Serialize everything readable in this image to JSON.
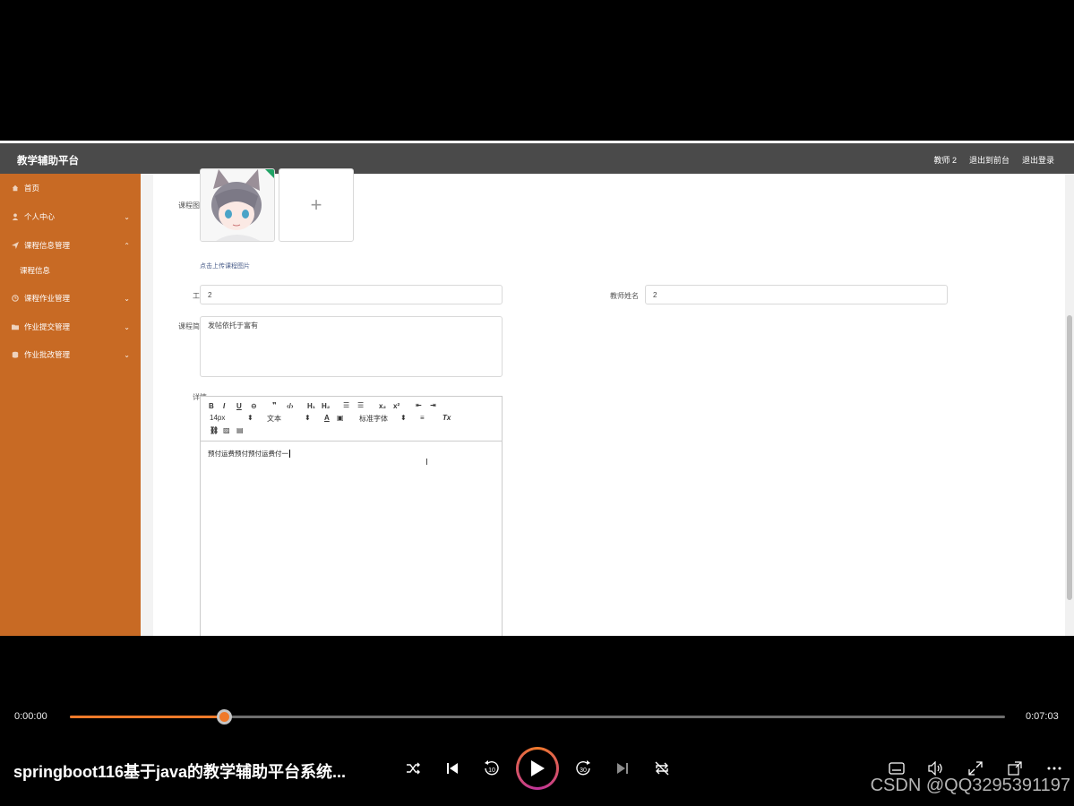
{
  "app": {
    "brand": "教学辅助平台",
    "user_links": [
      "教师 2",
      "退出到前台",
      "退出登录"
    ]
  },
  "sidebar": {
    "items": [
      {
        "label": "首页",
        "icon": "home-icon",
        "chevron": ""
      },
      {
        "label": "个人中心",
        "icon": "user-icon",
        "chevron": "⌄"
      },
      {
        "label": "课程信息管理",
        "icon": "send-icon",
        "chevron": "⌃"
      },
      {
        "label": "课程信息",
        "icon": "",
        "chevron": ""
      },
      {
        "label": "课程作业管理",
        "icon": "clock-icon",
        "chevron": "⌄"
      },
      {
        "label": "作业提交管理",
        "icon": "folder-icon",
        "chevron": "⌄"
      },
      {
        "label": "作业批改管理",
        "icon": "db-icon",
        "chevron": "⌄"
      }
    ]
  },
  "form": {
    "image_label": "课程图片",
    "upload_hint": "点击上传课程图片",
    "upload_plus": "+",
    "job_no_label": "工号",
    "job_no_value": "2",
    "teacher_name_label": "教师姓名",
    "teacher_name_value": "2",
    "intro_label": "课程简介",
    "intro_value": "发帖依托于富有",
    "detail_label": "详情"
  },
  "editor": {
    "font_size": "14px",
    "text_style": "文本",
    "font_family": "标准字体",
    "content": "预付运费预付预付运费付一"
  },
  "player": {
    "current_time": "0:00:00",
    "total_time": "0:07:03",
    "progress": 0.165,
    "title": "springboot116基于java的教学辅助平台系统...",
    "skip_back": "10",
    "skip_fwd": "30",
    "watermark": "CSDN @QQ3295391197",
    "accent": "#f07a2a"
  }
}
